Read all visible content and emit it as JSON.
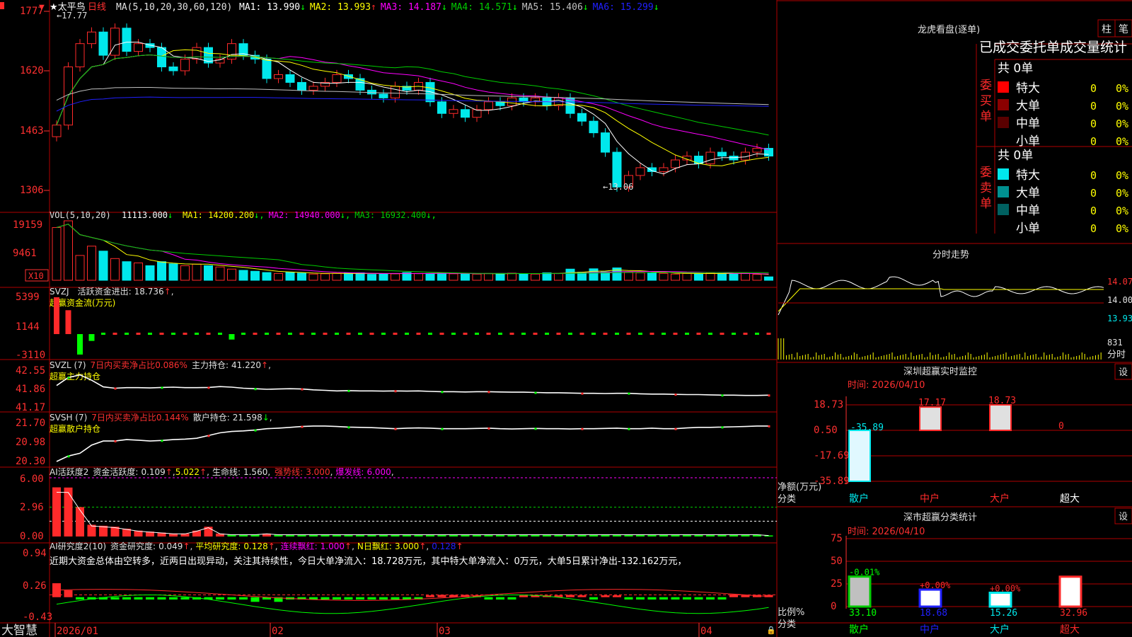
{
  "colors": {
    "up": "#ff2a2a",
    "down": "#00e8ec",
    "grid": "#b00000",
    "axis": "#ff3030",
    "text": "#e0e0e0",
    "yellow": "#ffff00",
    "magenta": "#ff00ff",
    "green": "#00cc00",
    "blue": "#2020ff",
    "white": "#ffffff",
    "lime": "#00ff00"
  },
  "app": {
    "brand": "大智慧",
    "fav_marker": "★",
    "stock_name": "太平鸟",
    "period": "日线"
  },
  "main_chart": {
    "ma_title": "MA(5,10,20,30,60,120)",
    "ma": [
      {
        "label": "MA1:",
        "value": "13.990",
        "arrow": "↓",
        "color": "#ffffff"
      },
      {
        "label": "MA2:",
        "value": "13.993",
        "arrow": "↑",
        "color": "#ffff00"
      },
      {
        "label": "MA3:",
        "value": "14.187",
        "arrow": "↓",
        "color": "#ff00ff"
      },
      {
        "label": "MA4:",
        "value": "14.571",
        "arrow": "↓",
        "color": "#00cc00"
      },
      {
        "label": "MA5:",
        "value": "15.406",
        "arrow": "↓",
        "color": "#c0c0c0"
      },
      {
        "label": "MA6:",
        "value": "15.299",
        "arrow": "↓",
        "color": "#2020ff"
      }
    ],
    "y_ticks": [
      "1777",
      "1620",
      "1463",
      "1306"
    ],
    "high_label": "17.77",
    "low_label": "13.06"
  },
  "vol_panel": {
    "title": "VOL(5,10,20)",
    "value": "11113.000",
    "arrow": "↓",
    "ma": [
      {
        "label": "MA1:",
        "value": "14200.200",
        "arrow": "↓",
        "color": "#ffff00"
      },
      {
        "label": "MA2:",
        "value": "14940.000",
        "arrow": "↓",
        "color": "#ff00ff"
      },
      {
        "label": "MA3:",
        "value": "16932.400",
        "arrow": "↓",
        "color": "#00cc00"
      }
    ],
    "y_ticks": [
      "19159",
      "9461"
    ],
    "unit": "X10"
  },
  "svzj_panel": {
    "code": "SVZJ",
    "label": "活跃资金进出:",
    "value": "18.736",
    "arrow": "↑",
    "subtitle": "超赢资金流(万元)",
    "y_ticks": [
      "5399",
      "1144",
      "-3110"
    ]
  },
  "svzl_panel": {
    "code": "SVZL (7)",
    "desc": "7日内买卖净占比",
    "desc_value": "0.086%",
    "label": "主力持仓:",
    "value": "41.220",
    "arrow": "↑",
    "subtitle": "超赢主力持仓",
    "y_ticks": [
      "42.55",
      "41.86",
      "41.17"
    ]
  },
  "svsh_panel": {
    "code": "SVSH (7)",
    "desc": "7日内买卖净占比",
    "desc_value": "0.144%",
    "label": "散户持仓:",
    "value": "21.598",
    "arrow": "↓",
    "subtitle": "超赢散户持仓",
    "y_ticks": [
      "21.70",
      "20.98",
      "20.30"
    ]
  },
  "ai_active_panel": {
    "code": "AI活跃度2",
    "label1": "资金活跃度:",
    "value1": "0.109",
    "arrow1": "↑",
    "value2": "5.022",
    "arrow2": "↑",
    "label3": "生命线:",
    "value3": "1.560",
    "label4": "强势线:",
    "value4": "3.000",
    "label5": "爆发线:",
    "value5": "6.000",
    "y_ticks": [
      "6.00",
      "2.96",
      "0.00"
    ]
  },
  "ai_research_panel": {
    "code": "AI研究度2(10)",
    "label1": "资金研究度:",
    "value1": "0.049",
    "arrow1": "↑",
    "label2": "平均研究度:",
    "value2": "0.128",
    "arrow2": "↑",
    "label3": "连续飘红:",
    "value3": "1.000",
    "arrow3": "↑",
    "label4": "N日飘红:",
    "value4": "3.000",
    "arrow4": "↑",
    "value5": "0.128",
    "arrow5": "↑",
    "comment": "近期大资金总体由空转多，近两日出现异动，关注其持续性，今日大单净流入：18.728万元，其中特大单净流入：0万元，大单5日累计净出-132.162万元，",
    "y_ticks": [
      "0.94",
      "0.26",
      "-0.43"
    ]
  },
  "x_axis": {
    "labels": [
      "2026/01",
      "02",
      "03",
      "04"
    ]
  },
  "right_panel": {
    "dragon_title": "龙虎看盘(逐单)",
    "btn_col": "柱",
    "btn_pen": "笔",
    "stats_title": "已成交委托单成交量统计",
    "buy": {
      "total": "共 0单",
      "side_label": "委买单",
      "rows": [
        {
          "name": "特大",
          "value": "0",
          "pct": "0%",
          "color": "#ff0000"
        },
        {
          "name": "大单",
          "value": "0",
          "pct": "0%",
          "color": "#8b0000"
        },
        {
          "name": "中单",
          "value": "0",
          "pct": "0%",
          "color": "#5a0000"
        },
        {
          "name": "小单",
          "value": "0",
          "pct": "0%",
          "color": "#000000"
        }
      ]
    },
    "sell": {
      "total": "共 0单",
      "side_label": "委卖单",
      "rows": [
        {
          "name": "特大",
          "value": "0",
          "pct": "0%",
          "color": "#00e8ec"
        },
        {
          "name": "大单",
          "value": "0",
          "pct": "0%",
          "color": "#009090"
        },
        {
          "name": "中单",
          "value": "0",
          "pct": "0%",
          "color": "#006060"
        },
        {
          "name": "小单",
          "value": "0",
          "pct": "0%",
          "color": "#000000"
        }
      ]
    },
    "intraday": {
      "title": "分时走势",
      "prices": [
        "14.07",
        "14.00",
        "13.93"
      ],
      "vol_value": "831",
      "vol_label": "分时"
    },
    "sz_monitor": {
      "title": "深圳超赢实时监控",
      "set": "设",
      "time": "时间: 2026/04/10",
      "y_ticks": [
        "18.73",
        "0.50",
        "-17.69",
        "-35.89"
      ],
      "y_label": "净额(万元)",
      "x_caption": "分类",
      "categories": [
        "散户",
        "中户",
        "大户",
        "超大"
      ],
      "values": [
        "-35.89",
        "17.17",
        "18.73",
        "0"
      ]
    },
    "sz_class": {
      "title": "深市超赢分类统计",
      "set": "设",
      "time": "时间: 2026/04/10",
      "y_ticks": [
        "75",
        "50",
        "25",
        "0"
      ],
      "y_label": "比例%",
      "x_caption": "分类",
      "categories": [
        "散户",
        "中户",
        "大户",
        "超大"
      ],
      "values": [
        "33.10",
        "18.68",
        "15.26",
        "32.96"
      ],
      "changes": [
        "-0.01%",
        "+0.00%",
        "+0.00%",
        ""
      ]
    }
  },
  "chart_data": [
    {
      "type": "candlestick",
      "title": "太平鸟 日线",
      "ylim": [
        13.06,
        17.77
      ],
      "high": 17.77,
      "low": 13.06,
      "close": [
        14.8,
        16.3,
        16.9,
        17.2,
        16.6,
        17.3,
        16.7,
        16.9,
        16.8,
        16.3,
        16.2,
        16.5,
        16.8,
        16.4,
        16.5,
        16.9,
        16.6,
        16.5,
        16.0,
        16.1,
        15.9,
        15.7,
        15.8,
        15.9,
        16.1,
        16.0,
        15.7,
        15.6,
        15.5,
        15.8,
        15.7,
        15.9,
        15.4,
        15.1,
        15.2,
        15.0,
        15.2,
        15.4,
        15.3,
        15.5,
        15.4,
        15.5,
        15.3,
        15.5,
        15.1,
        14.9,
        14.6,
        14.1,
        13.2,
        13.5,
        13.7,
        13.6,
        13.7,
        13.9,
        14.0,
        13.8,
        14.1,
        14.0,
        13.9,
        14.1,
        14.2,
        14.0
      ],
      "ma": {
        "MA1": 13.99,
        "MA2": 13.993,
        "MA3": 14.187,
        "MA4": 14.571,
        "MA5": 15.406,
        "MA6": 15.299
      }
    },
    {
      "type": "bar",
      "title": "VOL(5,10,20)",
      "ylim": [
        0,
        19159
      ],
      "values": [
        17000,
        19159,
        8000,
        11000,
        9400,
        7000,
        6000,
        5600,
        4700,
        6000,
        5300,
        4700,
        5200,
        4700,
        4300,
        3600,
        3200,
        2900,
        2500,
        2200,
        2600,
        2300,
        2000,
        2100,
        2200,
        2300,
        2400,
        1900,
        2000,
        2100,
        2500,
        2200,
        2200,
        2400,
        2100,
        2000,
        2000,
        2200,
        2200,
        2300,
        2100,
        2000,
        2400,
        2200,
        3600,
        2600,
        3700,
        2700,
        4000,
        2600,
        2400,
        2300,
        2200,
        2000,
        2200,
        2100,
        2300,
        2200,
        2100,
        2200,
        1900,
        1100
      ]
    },
    {
      "type": "bar",
      "title": "超赢资金流(万元)",
      "ylim": [
        -3110,
        5399
      ],
      "values": [
        5399,
        3500,
        -3000,
        -1000,
        0,
        0,
        0,
        0,
        0,
        0,
        0,
        0,
        0,
        0,
        0,
        -800,
        0,
        0,
        0,
        0,
        0,
        0,
        0,
        0,
        0,
        0,
        0,
        0,
        0,
        0,
        0,
        0,
        0,
        0,
        0,
        0,
        0,
        0,
        0,
        0,
        0,
        0,
        0,
        0,
        0,
        0,
        0,
        0,
        0,
        0,
        0,
        0,
        0,
        0,
        0,
        0,
        0,
        0,
        0,
        0,
        0,
        18.736
      ]
    },
    {
      "type": "line",
      "title": "超赢主力持仓",
      "ylim": [
        41.17,
        42.55
      ],
      "values": [
        42.0,
        42.3,
        42.4,
        42.2,
        41.95,
        41.9,
        41.92,
        41.92,
        41.91,
        41.93,
        41.94,
        41.92,
        41.92,
        41.93,
        41.96,
        41.94,
        41.9,
        41.88,
        41.86,
        41.87,
        41.88,
        41.87,
        41.84,
        41.82,
        41.8,
        41.81,
        41.8,
        41.8,
        41.79,
        41.8,
        41.79,
        41.8,
        41.78,
        41.77,
        41.77,
        41.76,
        41.77,
        41.77,
        41.76,
        41.75,
        41.75,
        41.74,
        41.73,
        41.73,
        41.72,
        41.71,
        41.71,
        41.7,
        41.71,
        41.71,
        41.69,
        41.68,
        41.68,
        41.67,
        41.66,
        41.66,
        41.65,
        41.64,
        41.64,
        41.63,
        41.63,
        41.64
      ]
    },
    {
      "type": "line",
      "title": "超赢散户持仓",
      "ylim": [
        20.3,
        21.7
      ],
      "values": [
        20.3,
        20.5,
        20.6,
        20.9,
        21.05,
        21.05,
        21.1,
        21.08,
        21.05,
        21.07,
        21.1,
        21.12,
        21.15,
        21.25,
        21.35,
        21.4,
        21.42,
        21.45,
        21.5,
        21.52,
        21.55,
        21.58,
        21.6,
        21.6,
        21.58,
        21.56,
        21.55,
        21.54,
        21.52,
        21.5,
        21.52,
        21.53,
        21.52,
        21.5,
        21.5,
        21.5,
        21.51,
        21.52,
        21.5,
        21.49,
        21.5,
        21.51,
        21.5,
        21.5,
        21.49,
        21.5,
        21.5,
        21.51,
        21.52,
        21.5,
        21.5,
        21.52,
        21.5,
        21.5,
        21.53,
        21.55,
        21.55,
        21.56,
        21.57,
        21.58,
        21.6,
        21.6
      ]
    },
    {
      "type": "bar",
      "title": "AI活跃度2",
      "ylim": [
        0,
        6
      ],
      "values": [
        5.02,
        5.0,
        3.0,
        1.2,
        1.1,
        1.0,
        0.8,
        0.6,
        0.5,
        0.4,
        0.3,
        0.3,
        0.6,
        1.0,
        0.3,
        0.2,
        0.2,
        0.2,
        0.3,
        0.2,
        0.2,
        0.2,
        0.2,
        0.2,
        0.2,
        0.2,
        0.2,
        0.2,
        0.2,
        0.2,
        0.2,
        0.2,
        0.2,
        0.2,
        0.2,
        0.2,
        0.2,
        0.2,
        0.2,
        0.2,
        0.2,
        0.2,
        0.2,
        0.2,
        0.2,
        0.2,
        0.2,
        0.2,
        0.2,
        0.2,
        0.2,
        0.2,
        0.2,
        0.2,
        0.2,
        0.2,
        0.2,
        0.2,
        0.2,
        0.2,
        0.2,
        0.109
      ],
      "lines": {
        "生命线": 1.56,
        "强势线": 3.0,
        "爆发线": 6.0
      }
    },
    {
      "type": "bar",
      "title": "AI研究度2(10)",
      "ylim": [
        -0.43,
        0.94
      ],
      "values": [
        0.3,
        0.15,
        -0.05,
        -0.05,
        -0.05,
        -0.05,
        -0.05,
        -0.05,
        -0.05,
        -0.05,
        -0.05,
        -0.05,
        -0.05,
        -0.05,
        -0.05,
        -0.05,
        -0.05,
        -0.1,
        -0.05,
        -0.1,
        -0.05,
        -0.05,
        -0.05,
        -0.05,
        -0.05,
        -0.05,
        -0.05,
        -0.05,
        -0.05,
        -0.05,
        -0.05,
        -0.05,
        0.04,
        0.05,
        0.05,
        0.05,
        0.04,
        -0.05,
        -0.05,
        -0.05,
        0.04,
        0.05,
        0.04,
        0.04,
        0.05,
        0.04,
        -0.05,
        0.04,
        0.04,
        -0.05,
        -0.05,
        -0.05,
        -0.05,
        -0.05,
        -0.05,
        -0.05,
        -0.05,
        -0.05,
        0.06,
        0.05,
        0.05,
        0.049
      ]
    },
    {
      "type": "bar",
      "title": "深圳超赢实时监控",
      "categories": [
        "散户",
        "中户",
        "大户",
        "超大"
      ],
      "values": [
        -35.89,
        17.17,
        18.73,
        0
      ],
      "ylim": [
        -35.89,
        18.73
      ],
      "ylabel": "净额(万元)",
      "xlabel": "分类"
    },
    {
      "type": "bar",
      "title": "深市超赢分类统计",
      "categories": [
        "散户",
        "中户",
        "大户",
        "超大"
      ],
      "values": [
        33.1,
        18.68,
        15.26,
        32.96
      ],
      "ylim": [
        0,
        75
      ],
      "ylabel": "比例%",
      "xlabel": "分类"
    }
  ]
}
